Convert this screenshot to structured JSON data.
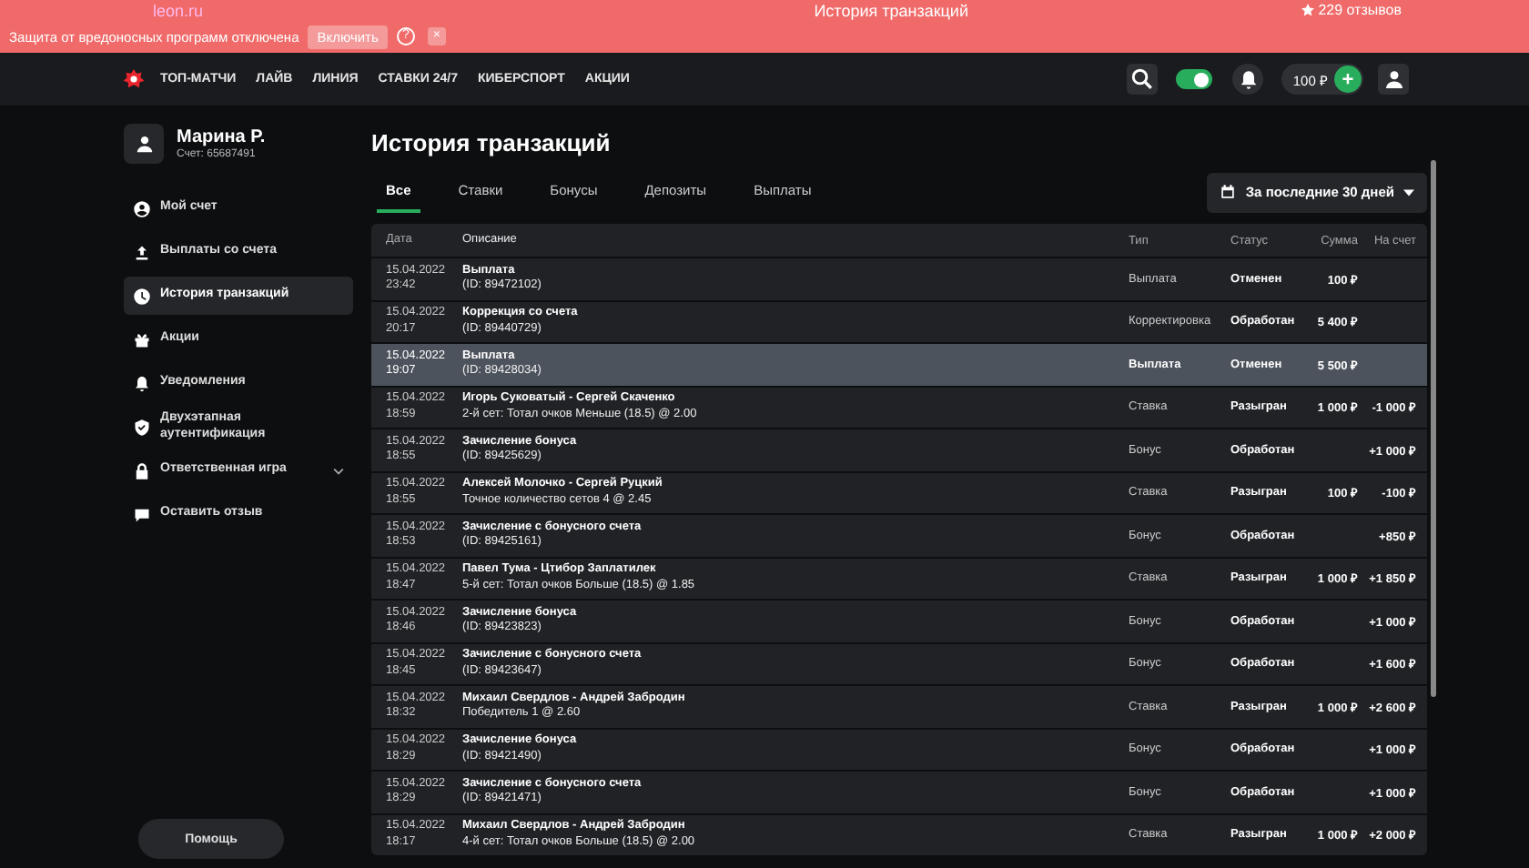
{
  "browser": {
    "url": "leon.ru",
    "title": "История транзакций",
    "reviews": "229 отзывов"
  },
  "warning": {
    "text": "Защита от вредоносных программ отключена",
    "button": "Включить",
    "help": "?",
    "close": "×"
  },
  "nav": {
    "items": [
      "ТОП-МАТЧИ",
      "ЛАЙВ",
      "ЛИНИЯ",
      "СТАВКИ 24/7",
      "КИБЕРСПОРТ",
      "АКЦИИ"
    ],
    "theme_on": true,
    "balance": "100 ₽",
    "deposit": "+"
  },
  "profile": {
    "name": "Марина Р.",
    "account": "Счет: 65687491"
  },
  "sidebar": {
    "items": [
      {
        "label": "Мой счет",
        "selected": false
      },
      {
        "label": "Выплаты со счета",
        "selected": false
      },
      {
        "label": "История транзакций",
        "selected": true
      },
      {
        "label": "Акции",
        "selected": false
      },
      {
        "label": "Уведомления",
        "selected": false
      },
      {
        "label": "Двухэтапная аутентификация",
        "selected": false
      },
      {
        "label": "Ответственная игра",
        "selected": false,
        "expandable": true
      },
      {
        "label": "Оставить отзыв",
        "selected": false
      }
    ],
    "help": "Помощь"
  },
  "page_title": "История транзакций",
  "tabs": [
    {
      "label": "Все",
      "selected": true
    },
    {
      "label": "Ставки",
      "selected": false
    },
    {
      "label": "Бонусы",
      "selected": false
    },
    {
      "label": "Депозиты",
      "selected": false
    },
    {
      "label": "Выплаты",
      "selected": false
    }
  ],
  "period": "За последние 30 дней",
  "table": {
    "columns": [
      "Дата",
      "Описание",
      "Тип",
      "Статус",
      "Сумма",
      "На счет"
    ],
    "rows": [
      {
        "date": "15.04.2022",
        "time": "23:42",
        "title": "Выплата",
        "detail": "(ID: 89472102)",
        "type": "Выплата",
        "status": "Отменен",
        "amount": "100 ₽",
        "selected": false
      },
      {
        "date": "15.04.2022",
        "time": "20:17",
        "title": "Коррекция со счета",
        "detail": "(ID: 89440729)",
        "type": "Корректировка",
        "status": "Обработан",
        "amount": "5 400 ₽",
        "selected": false
      },
      {
        "date": "15.04.2022",
        "time": "19:07",
        "title": "Выплата",
        "detail": "(ID: 89428034)",
        "type": "Выплата",
        "status": "Отменен",
        "amount": "5 500 ₽",
        "selected": true
      },
      {
        "date": "15.04.2022",
        "time": "18:59",
        "title": "Игорь Суковатый - Сергей Скаченко",
        "detail": "2-й сет: Тотал очков Меньше (18.5) @ 2.00",
        "type": "Ставка",
        "status": "Разыгран",
        "amount": "1 000 ₽",
        "balance": "-1 000 ₽",
        "selected": false
      },
      {
        "date": "15.04.2022",
        "time": "18:55",
        "title": "Зачисление бонуса",
        "detail": "(ID: 89425629)",
        "type": "Бонус",
        "status": "Обработан",
        "balance": "+1 000 ₽",
        "selected": false
      },
      {
        "date": "15.04.2022",
        "time": "18:55",
        "title": "Алексей Молочко - Сергей Руцкий",
        "detail": "Точное количество сетов 4 @ 2.45",
        "type": "Ставка",
        "status": "Разыгран",
        "amount": "100 ₽",
        "balance": "-100 ₽",
        "selected": false
      },
      {
        "date": "15.04.2022",
        "time": "18:53",
        "title": "Зачисление с бонусного счета",
        "detail": "(ID: 89425161)",
        "type": "Бонус",
        "status": "Обработан",
        "balance": "+850 ₽",
        "selected": false
      },
      {
        "date": "15.04.2022",
        "time": "18:47",
        "title": "Павел Тума - Цтибор Заплатилек",
        "detail": "5-й сет: Тотал очков Больше (18.5) @ 1.85",
        "type": "Ставка",
        "status": "Разыгран",
        "amount": "1 000 ₽",
        "balance": "+1 850 ₽",
        "selected": false
      },
      {
        "date": "15.04.2022",
        "time": "18:46",
        "title": "Зачисление бонуса",
        "detail": "(ID: 89423823)",
        "type": "Бонус",
        "status": "Обработан",
        "balance": "+1 000 ₽",
        "selected": false
      },
      {
        "date": "15.04.2022",
        "time": "18:45",
        "title": "Зачисление с бонусного счета",
        "detail": "(ID: 89423647)",
        "type": "Бонус",
        "status": "Обработан",
        "balance": "+1 600 ₽",
        "selected": false
      },
      {
        "date": "15.04.2022",
        "time": "18:32",
        "title": "Михаил Свердлов - Андрей Забродин",
        "detail": "Победитель 1 @ 2.60",
        "type": "Ставка",
        "status": "Разыгран",
        "amount": "1 000 ₽",
        "balance": "+2 600 ₽",
        "selected": false
      },
      {
        "date": "15.04.2022",
        "time": "18:29",
        "title": "Зачисление бонуса",
        "detail": "(ID: 89421490)",
        "type": "Бонус",
        "status": "Обработан",
        "balance": "+1 000 ₽",
        "selected": false
      },
      {
        "date": "15.04.2022",
        "time": "18:29",
        "title": "Зачисление с бонусного счета",
        "detail": "(ID: 89421471)",
        "type": "Бонус",
        "status": "Обработан",
        "balance": "+1 000 ₽",
        "selected": false
      },
      {
        "date": "15.04.2022",
        "time": "18:17",
        "title": "Михаил Свердлов - Андрей Забродин",
        "detail": "4-й сет: Тотал очков Больше (18.5) @ 2.00",
        "type": "Ставка",
        "status": "Разыгран",
        "amount": "1 000 ₽",
        "balance": "+2 000 ₽",
        "selected": false
      }
    ]
  }
}
